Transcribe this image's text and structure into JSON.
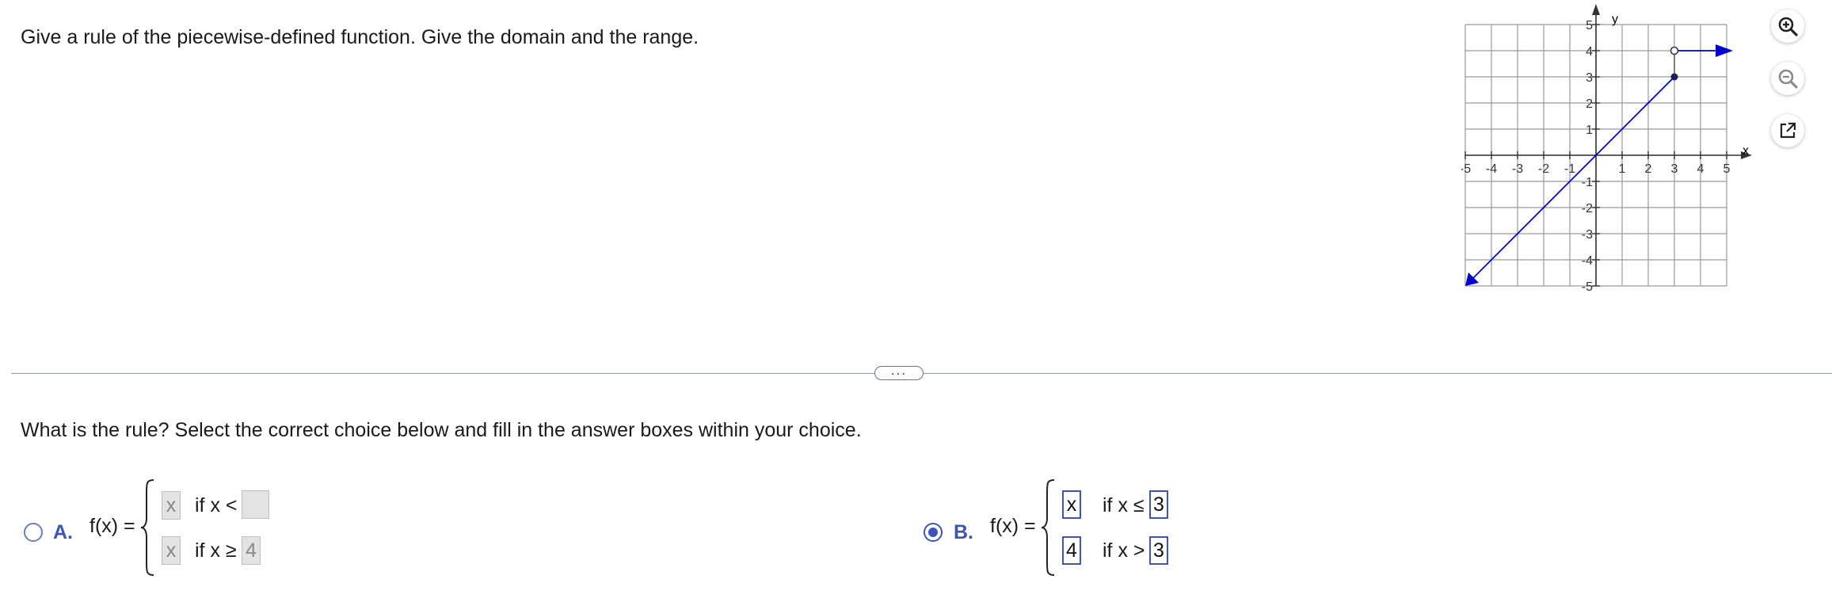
{
  "question": "Give a rule of the piecewise-defined function. Give the domain and the range.",
  "graph": {
    "x_axis_label": "x",
    "y_axis_label": "y",
    "x_tick_labels": [
      "-5",
      "-4",
      "-3",
      "-2",
      "-1",
      "1",
      "2",
      "3",
      "4",
      "5"
    ],
    "y_tick_labels": [
      "5",
      "4",
      "3",
      "2",
      "1",
      "-1",
      "-2",
      "-3",
      "-4",
      "-5"
    ],
    "line_color": "#0000cc"
  },
  "tools": {
    "zoom_in": "zoom-in-icon",
    "zoom_out": "zoom-out-icon",
    "open_new": "external-link-icon"
  },
  "expander_label": "...",
  "prompt": "What is the rule? Select the correct choice below and fill in the answer boxes within your choice.",
  "choices": {
    "a": {
      "letter": "A.",
      "selected": false,
      "fx_label": "f(x) =",
      "row1": {
        "expr": "x",
        "cond": "if x <",
        "bound": ""
      },
      "row2": {
        "expr": "x",
        "cond": "if x ≥",
        "bound": "4"
      }
    },
    "b": {
      "letter": "B.",
      "selected": true,
      "fx_label": "f(x) =",
      "row1": {
        "expr": "x",
        "cond": "if x ≤",
        "bound": "3"
      },
      "row2": {
        "expr": "4",
        "cond": "if x >",
        "bound": "3"
      }
    }
  }
}
